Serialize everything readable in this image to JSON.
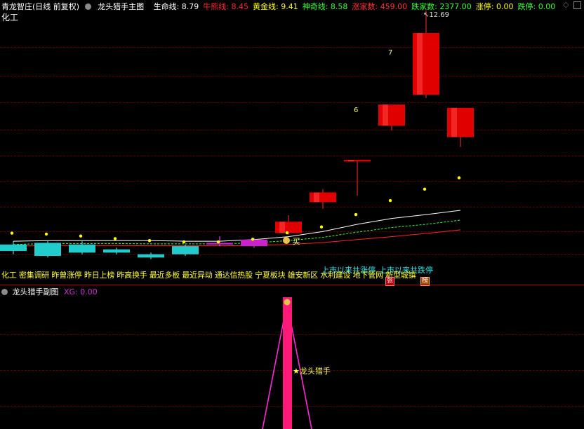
{
  "header": {
    "title": "青龙智庄(日线 前复权)",
    "main_chart_name": "龙头猎手主图",
    "sector": "化工",
    "indicators": [
      {
        "label": "生命线",
        "value": "8.79",
        "color": "#ffffff"
      },
      {
        "label": "牛熊线",
        "value": "8.45",
        "color": "#ff2a2a"
      },
      {
        "label": "黄金线",
        "value": "9.41",
        "color": "#ffff00"
      },
      {
        "label": "神奇线",
        "value": "8.58",
        "color": "#33ff33"
      },
      {
        "label": "涨家数",
        "value": "459.00",
        "color": "#ff3333"
      },
      {
        "label": "跌家数",
        "value": "2377.00",
        "color": "#33ff33"
      },
      {
        "label": "涨停",
        "value": "0.00",
        "color": "#ffff00"
      },
      {
        "label": "跌停",
        "value": "0.00",
        "color": "#33ff33"
      }
    ]
  },
  "main": {
    "price_high_label": "12.69",
    "candle_counts": [
      "6",
      "7"
    ],
    "buy_label": "买",
    "tags_line": "化工 密集调研 昨曾涨停 昨日上榜 昨高换手 最近多板 最近异动 通达信热股 宁夏板块 雄安新区 水利建设 地下管网 新型城镇",
    "notice_limit_up": "上市以来共涨停",
    "notice_limit_down": "上市以来共跌停",
    "badge_zhang": "张",
    "badge_bang": "榜"
  },
  "sub": {
    "title": "龙头猎手副图",
    "xg_label": "XG: 0.00",
    "hunter_label": "★龙头猎手"
  },
  "chart_data": {
    "type": "candlestick",
    "y_max_label": 12.69,
    "candles": [
      {
        "open": 5.5,
        "close": 5.3,
        "high": 5.6,
        "low": 5.2,
        "color": "cyan"
      },
      {
        "open": 5.55,
        "close": 5.15,
        "high": 5.6,
        "low": 5.1,
        "color": "cyan"
      },
      {
        "open": 5.5,
        "close": 5.25,
        "high": 5.6,
        "low": 5.2,
        "color": "cyan"
      },
      {
        "open": 5.35,
        "close": 5.25,
        "high": 5.4,
        "low": 5.2,
        "color": "cyan"
      },
      {
        "open": 5.2,
        "close": 5.1,
        "high": 5.25,
        "low": 5.05,
        "color": "cyan"
      },
      {
        "open": 5.45,
        "close": 5.2,
        "high": 5.5,
        "low": 5.15,
        "color": "cyan"
      },
      {
        "open": 5.55,
        "close": 5.5,
        "high": 5.75,
        "low": 5.45,
        "color": "magenta"
      },
      {
        "open": 5.45,
        "close": 5.65,
        "high": 5.7,
        "low": 5.4,
        "color": "magenta"
      },
      {
        "open": 5.85,
        "close": 6.2,
        "high": 6.4,
        "low": 5.8,
        "color": "red"
      },
      {
        "open": 6.8,
        "close": 7.1,
        "high": 7.2,
        "low": 6.6,
        "color": "red"
      },
      {
        "open": 8.05,
        "close": 8.1,
        "high": 8.1,
        "low": 7.0,
        "color": "red"
      },
      {
        "open": 9.15,
        "close": 9.8,
        "high": 9.8,
        "low": 9.0,
        "color": "red"
      },
      {
        "open": 10.1,
        "close": 12.0,
        "high": 12.69,
        "low": 10.0,
        "color": "red"
      },
      {
        "open": 8.8,
        "close": 9.7,
        "high": 9.7,
        "low": 8.5,
        "color": "red"
      }
    ],
    "dots": [
      5.85,
      5.82,
      5.76,
      5.68,
      5.62,
      5.58,
      5.58,
      5.66,
      5.86,
      6.04,
      6.42,
      6.85,
      7.2,
      7.55
    ],
    "life_line": [
      5.6,
      5.62,
      5.62,
      5.62,
      5.62,
      5.6,
      5.6,
      5.65,
      5.74,
      5.9,
      6.12,
      6.3,
      6.42,
      6.55
    ],
    "golden_line": [
      5.5,
      5.53,
      5.53,
      5.53,
      5.52,
      5.52,
      5.52,
      5.55,
      5.62,
      5.72,
      5.88,
      6.02,
      6.12,
      6.25
    ],
    "bull_bear_line": [
      5.45,
      5.47,
      5.47,
      5.47,
      5.46,
      5.46,
      5.46,
      5.47,
      5.5,
      5.56,
      5.65,
      5.74,
      5.84,
      5.95
    ]
  }
}
